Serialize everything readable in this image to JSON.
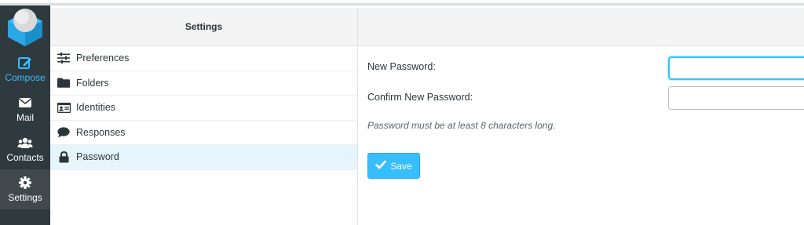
{
  "nav": {
    "items": [
      {
        "label": "Compose",
        "icon": "compose-icon",
        "active": false,
        "color": "#37beff"
      },
      {
        "label": "Mail",
        "icon": "mail-icon"
      },
      {
        "label": "Contacts",
        "icon": "contacts-icon"
      },
      {
        "label": "Settings",
        "icon": "gear-icon",
        "active": true
      }
    ]
  },
  "settings_list": {
    "title": "Settings",
    "items": [
      {
        "label": "Preferences",
        "icon": "sliders-icon"
      },
      {
        "label": "Folders",
        "icon": "folder-icon"
      },
      {
        "label": "Identities",
        "icon": "id-card-icon"
      },
      {
        "label": "Responses",
        "icon": "comment-icon"
      },
      {
        "label": "Password",
        "icon": "lock-icon",
        "selected": true
      }
    ]
  },
  "form": {
    "new_password_label": "New Password:",
    "new_password_value": "",
    "confirm_password_label": "Confirm New Password:",
    "confirm_password_value": "",
    "hint": "Password must be at least 8 characters long.",
    "save_label": "Save"
  },
  "colors": {
    "accent": "#37beff",
    "nav_bg": "#2f3a3f",
    "selected_bg": "#e6f5fd"
  }
}
